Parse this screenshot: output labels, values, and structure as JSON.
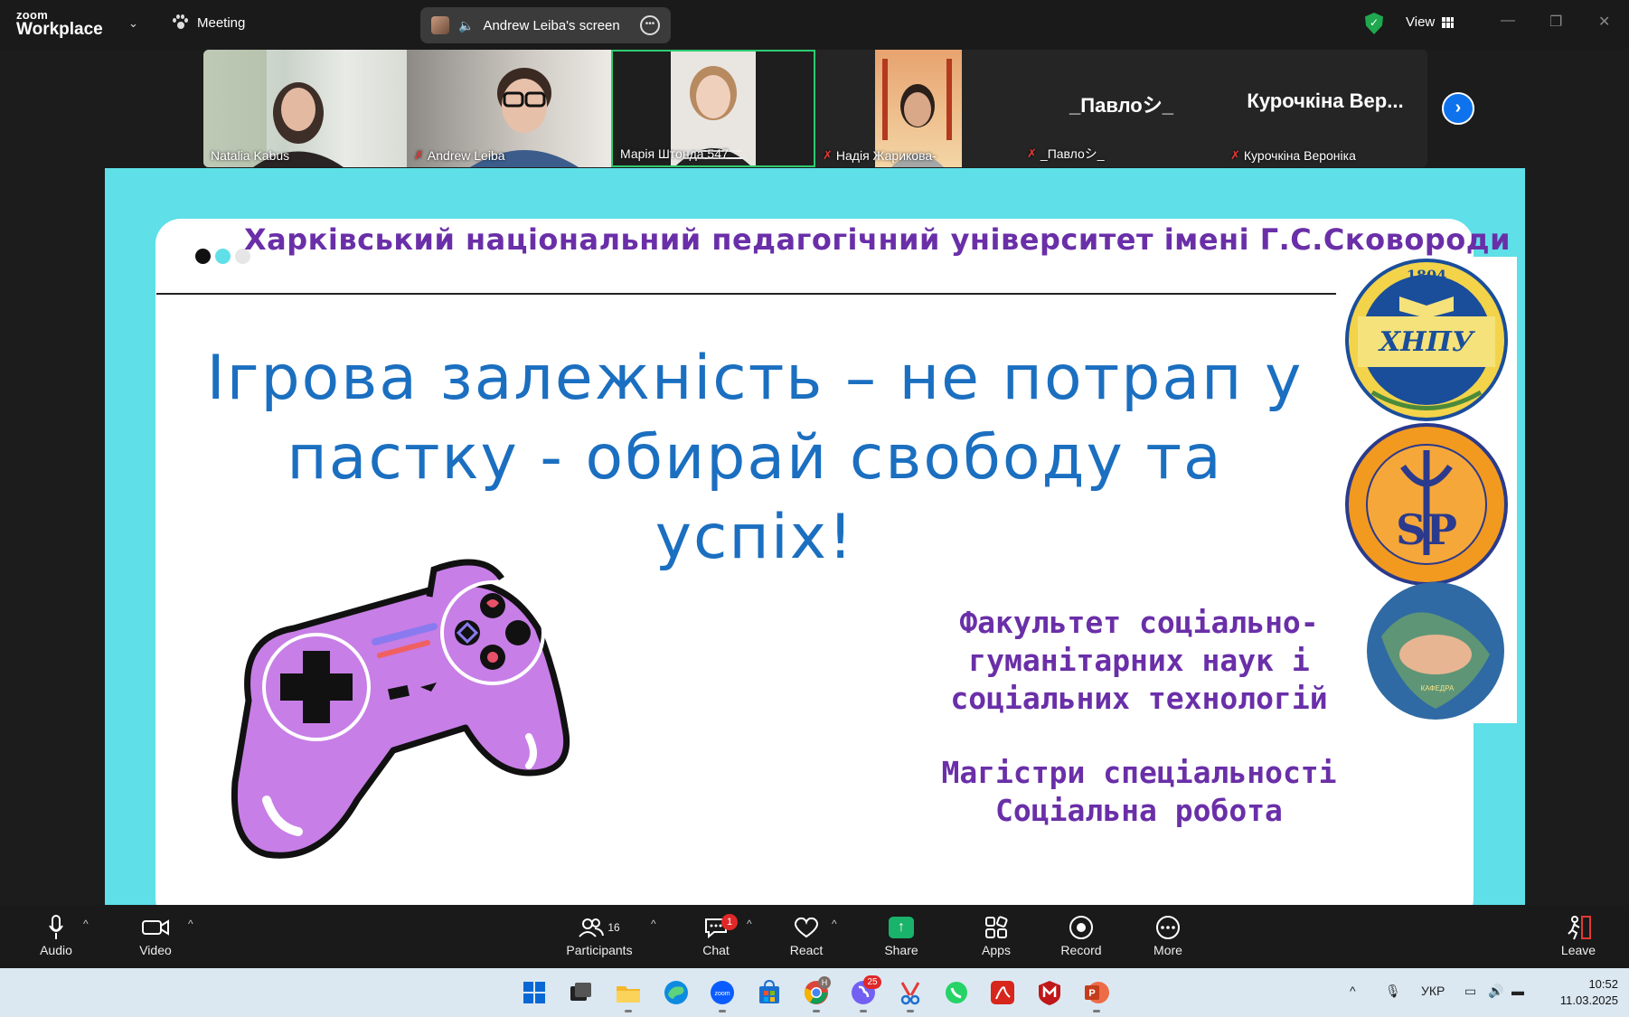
{
  "topbar": {
    "logo_line1": "zoom",
    "logo_line2": "Workplace",
    "meeting_label": "Meeting",
    "sharing_label": "Andrew Leiba's screen",
    "view_label": "View"
  },
  "gallery": {
    "participants": [
      {
        "name": "Natalia Kabus",
        "muted": false
      },
      {
        "name": "Andrew Leiba",
        "muted": true
      },
      {
        "name": "Марія Штонда 547",
        "muted": false,
        "active": true
      },
      {
        "name": "Надія Жарикова-",
        "muted": true
      },
      {
        "name": "_Павлоシ_",
        "muted": true,
        "display": "_Павлоシ_"
      },
      {
        "name": "Курочкіна Вероніка",
        "muted": true,
        "display": "Курочкіна Вер..."
      }
    ]
  },
  "slide": {
    "university": "Харківський національний педагогічний університет імені Г.С.Сковороди",
    "title_line1": "Ігрова залежність – не потрап у",
    "title_line2": "пастку - обирай свободу та",
    "title_line3": "успіх!",
    "faculty_line1": "Факультет соціально-",
    "faculty_line2": "гуманітарних наук і",
    "faculty_line3": "соціальних технологій",
    "master_line1": "Магістри спеціальності",
    "master_line2": "Соціальна робота",
    "logo1_year": "1804",
    "logo1_text": "ХНПУ",
    "logo2_text": "SP",
    "colors": {
      "frame": "#5fdfe8",
      "purple": "#6a2fa8",
      "blue": "#1b6fc0"
    }
  },
  "toolbar": {
    "audio": "Audio",
    "video": "Video",
    "participants": "Participants",
    "participants_count": "16",
    "chat": "Chat",
    "chat_badge": "1",
    "react": "React",
    "share": "Share",
    "apps": "Apps",
    "record": "Record",
    "more": "More",
    "leave": "Leave"
  },
  "taskbar": {
    "language": "УКР",
    "time": "10:52",
    "date": "11.03.2025",
    "chrome_badge": "H",
    "viber_badge": "25"
  }
}
